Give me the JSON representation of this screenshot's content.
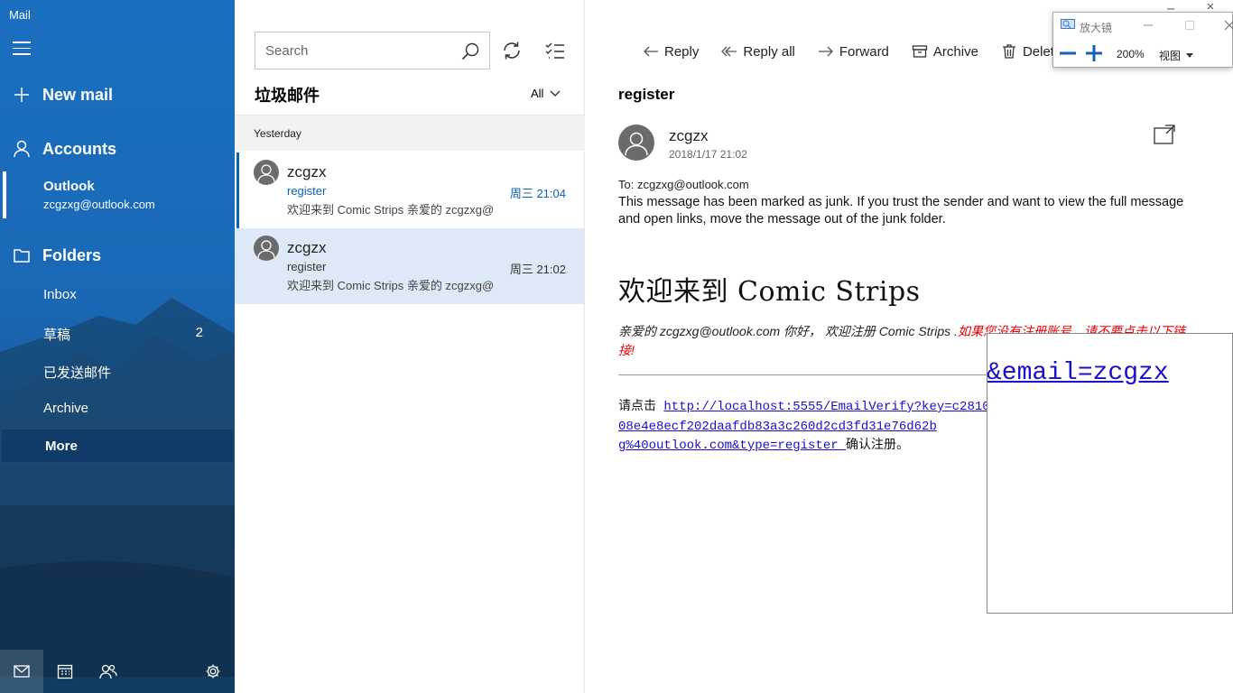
{
  "app": {
    "title": "Mail"
  },
  "nav": {
    "new_mail": "New mail",
    "accounts": "Accounts",
    "account": {
      "name": "Outlook",
      "email": "zcgzxg@outlook.com"
    },
    "folders_label": "Folders",
    "folders": [
      {
        "label": "Inbox",
        "count": ""
      },
      {
        "label": "草稿",
        "count": "2"
      },
      {
        "label": "已发送邮件",
        "count": ""
      },
      {
        "label": "Archive",
        "count": ""
      },
      {
        "label": "More",
        "count": ""
      }
    ]
  },
  "list": {
    "search_placeholder": "Search",
    "folder_title": "垃圾邮件",
    "filter": "All",
    "group": "Yesterday",
    "messages": [
      {
        "sender": "zcgzx",
        "subject": "register",
        "preview": "欢迎来到 Comic Strips  亲爱的 zcgzxg@",
        "time": "周三 21:04"
      },
      {
        "sender": "zcgzx",
        "subject": "register",
        "preview": "欢迎来到 Comic Strips  亲爱的 zcgzxg@",
        "time": "周三 21:02"
      }
    ]
  },
  "reader": {
    "toolbar": {
      "reply": "Reply",
      "reply_all": "Reply all",
      "forward": "Forward",
      "archive": "Archive",
      "delete": "Delete"
    },
    "subject": "register",
    "sender": "zcgzx",
    "date": "2018/1/17 21:02",
    "to": "To: zcgzxg@outlook.com",
    "junk_notice": "This message has been marked as junk. If you trust the sender and want to view the full message and open links, move the message out of the junk folder.",
    "heading": "欢迎来到 Comic Strips",
    "greeting": "亲爱的 zcgzxg@outlook.com 你好， 欢迎注册 Comic Strips .",
    "greeting_warning": "如果您没有注册账号，请不要点击以下链接!",
    "link_prefix": "请点击 ",
    "link": "http://localhost:5555/EmailVerify?key=c281008e4e8ecf202daafdb83a3c260d2cd3fd31e76d62b",
    "link_tail": "g%40outlook.com&type=register ",
    "link_suffix": "确认注册。"
  },
  "magnifier": {
    "title": "放大镜",
    "zoom": "200%",
    "view": "视图",
    "lens_text": "&email=zcgzx"
  },
  "colors": {
    "accent": "#0a64b4",
    "nav_bg": "#1a69b7",
    "selected_bg": "#dde9f6",
    "link": "#1a0dcc",
    "warning": "#ee0000"
  }
}
